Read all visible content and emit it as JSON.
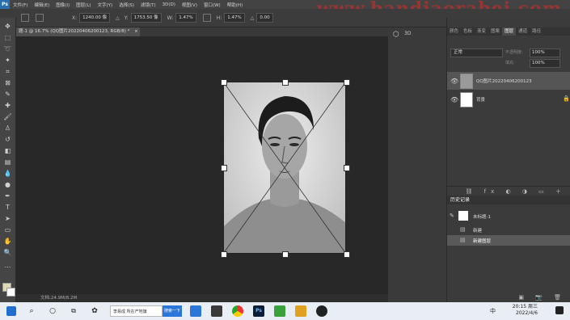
{
  "menu": {
    "logo": "Ps",
    "items": [
      "文件(F)",
      "编辑(E)",
      "图像(I)",
      "图层(L)",
      "文字(Y)",
      "选择(S)",
      "滤镜(T)",
      "3D(D)",
      "视图(V)",
      "窗口(W)",
      "帮助(H)"
    ]
  },
  "watermark": "www.bandiaorabei.com",
  "options": {
    "x_label": "X:",
    "x_value": "1240.00 像",
    "y_label": "Y:",
    "y_value": "1753.50 像",
    "w_label": "W:",
    "w_value": "1.47%",
    "h_label": "H:",
    "h_value": "1.47%",
    "angle_label": "△",
    "angle_value": "0.00"
  },
  "document": {
    "tab_title": "题-1 @ 16.7% (QQ图片20220406200123, RGB/8) *",
    "tab_close": "×",
    "status": "文档:24.9M/8.2M"
  },
  "panel": {
    "tabs": [
      "颜色",
      "色板",
      "渐变",
      "图案",
      "图层",
      "通道",
      "路径"
    ],
    "active_tab": "图层",
    "blend_mode": "正常",
    "opacity_label": "不透明度:",
    "opacity_value": "100%",
    "fill_label": "填充:",
    "fill_value": "100%",
    "layers": [
      {
        "name": "QQ图片20220406200123"
      },
      {
        "name": "背景"
      }
    ],
    "history_title": "历史记录",
    "history_source": "未标题-1",
    "history_items": [
      "新建",
      "新建图层"
    ]
  },
  "taskbar": {
    "search_text": "李易成 所在产地旗",
    "search_button": "搜索一下",
    "ime": "中",
    "time": "20:15 周三",
    "date": "2022/4/6"
  },
  "colors": {
    "foreground": "#dcd8b8",
    "background": "#ffffff",
    "accent": "#2b76d8"
  }
}
